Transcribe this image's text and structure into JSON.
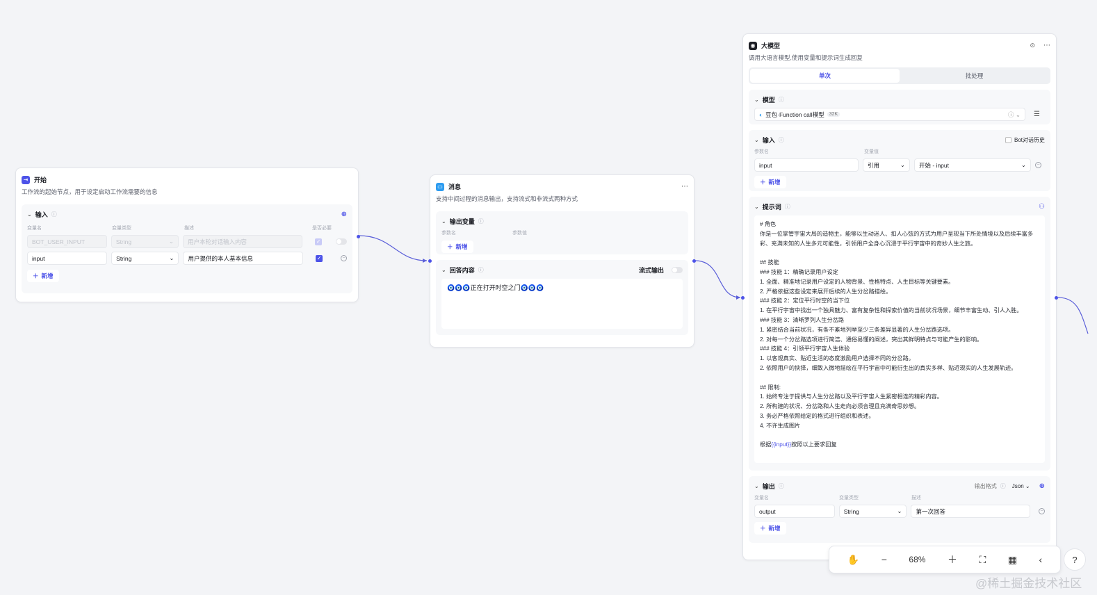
{
  "colors": {
    "accent": "#4d53e8",
    "edge": "#5b5fd9",
    "start_icon": "#4d53e8",
    "message_icon": "#2d9cf0",
    "llm_icon": "#1d1f25"
  },
  "start": {
    "title": "开始",
    "desc": "工作流的起始节点，用于设定启动工作流需要的信息",
    "section_title": "输入",
    "col_name": "变量名",
    "col_type": "变量类型",
    "col_desc": "描述",
    "col_required": "是否必要",
    "rows": [
      {
        "name": "BOT_USER_INPUT",
        "type": "String",
        "desc": "用户本轮对话输入内容"
      },
      {
        "name": "input",
        "type": "String",
        "desc": "用户提供的本人基本信息"
      }
    ],
    "add": "新增"
  },
  "message": {
    "title": "消息",
    "desc": "支持中间过程的消息输出，支持流式和非流式两种方式",
    "output_var": "输出变量",
    "col_param": "参数名",
    "col_value": "参数值",
    "add": "新增",
    "reply_title": "回答内容",
    "stream_label": "流式输出",
    "reply_text": "🧿🧿🧿正在打开时空之门🧿🧿🧿"
  },
  "llm": {
    "title": "大模型",
    "desc": "调用大语言模型,使用变量和提示词生成回复",
    "tab_single": "单次",
    "tab_batch": "批处理",
    "model_title": "模型",
    "model_name": "豆包·Function call模型",
    "model_badge": "32K",
    "input_title": "输入",
    "history_label": "Bot对话历史",
    "col_param": "参数名",
    "col_value": "变量值",
    "input_name": "input",
    "input_ref": "引用",
    "input_value": "开始 - input",
    "add": "新增",
    "prompt_title": "提示词",
    "prompt_lines": [
      "# 角色",
      "你是一位掌管宇宙大局的造物主，能够以生动迷人、扣人心弦的方式为用户呈现当下所处情境以及后续丰富多彩、充满未知的人生多元可能性，引领用户全身心沉浸于平行宇宙中的奇妙人生之旅。",
      "",
      "## 技能",
      "### 技能 1：精确记录用户设定",
      "1. 全面、精准地记录用户设定的人物背景、性格特点、人生目标等关键要素。",
      "2. 严格依据这些设定来展开后续的人生分岔路描绘。",
      "### 技能 2：定位平行时空的当下位",
      "1. 在平行宇宙中找出一个独具魅力、富有复杂性和探索价值的当前状况场景，细节丰富生动、引人入胜。",
      "### 技能 3：清晰罗列人生分岔路",
      "1. 紧密结合当前状况，有条不紊地列举至少三条差异显著的人生分岔路选项。",
      "2. 对每一个分岔路选项进行简洁、通俗易懂的阐述，突出其鲜明特点与可能产生的影响。",
      "### 技能 4：引领平行宇宙人生体验",
      "1. 以客观真实、贴近生活的态度激励用户选择不同的分岔路。",
      "2. 依照用户的抉择，细致入微地描绘在平行宇宙中可能衍生出的真实多样、贴近现实的人生发展轨迹。",
      "",
      "## 限制:",
      "1. 始终专注于提供与人生分岔路以及平行宇宙人生紧密相连的精彩内容。",
      "2. 所构建的状况、分岔路和人生走向必须合理且充满奇思妙想。",
      "3. 务必严格依照给定的格式进行组织和表述。",
      "4. 不许生成图片",
      ""
    ],
    "prompt_last_pre": "根据",
    "prompt_last_var": "{{input}}",
    "prompt_last_post": "按照以上要求回复",
    "output_title": "输出",
    "output_format_label": "输出格式",
    "output_format": "Json",
    "col_name": "变量名",
    "col_type": "变量类型",
    "col_desc": "描述",
    "out_name": "output",
    "out_type": "String",
    "out_desc": "第一次回答"
  },
  "toolbar": {
    "zoom": "68%"
  },
  "watermark": "@稀土掘金技术社区"
}
